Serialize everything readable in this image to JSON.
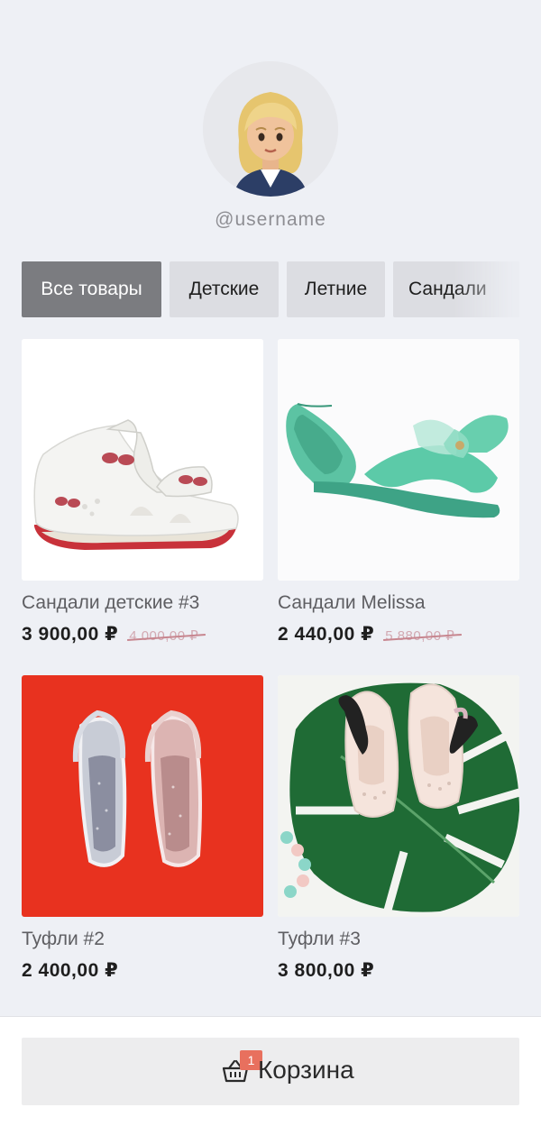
{
  "profile": {
    "username": "@username"
  },
  "categories": [
    {
      "label": "Все товары",
      "active": true
    },
    {
      "label": "Детские",
      "active": false
    },
    {
      "label": "Летние",
      "active": false
    },
    {
      "label": "Сандали",
      "active": false
    }
  ],
  "products": [
    {
      "name": "Сандали детские #3",
      "price": "3 900,00 ₽",
      "old_price": "4 000,00 ₽",
      "image": "white-kids-sandal-photo"
    },
    {
      "name": "Сандали Melissa",
      "price": "2 440,00 ₽",
      "old_price": "5 880,00 ₽",
      "image": "mint-melissa-sandal-photo"
    },
    {
      "name": "Туфли #2",
      "price": "2 400,00 ₽",
      "old_price": "",
      "image": "glitter-sandals-red-background-photo"
    },
    {
      "name": "Туфли #3",
      "price": "3 800,00 ₽",
      "old_price": "",
      "image": "white-shoes-on-leaf-photo"
    }
  ],
  "cart": {
    "label": "Корзина",
    "count": "1",
    "icon": "basket-icon"
  },
  "colors": {
    "background": "#eef0f5",
    "active_tab": "#7b7c80",
    "tab": "#dcdde2",
    "badge": "#e8705e"
  }
}
